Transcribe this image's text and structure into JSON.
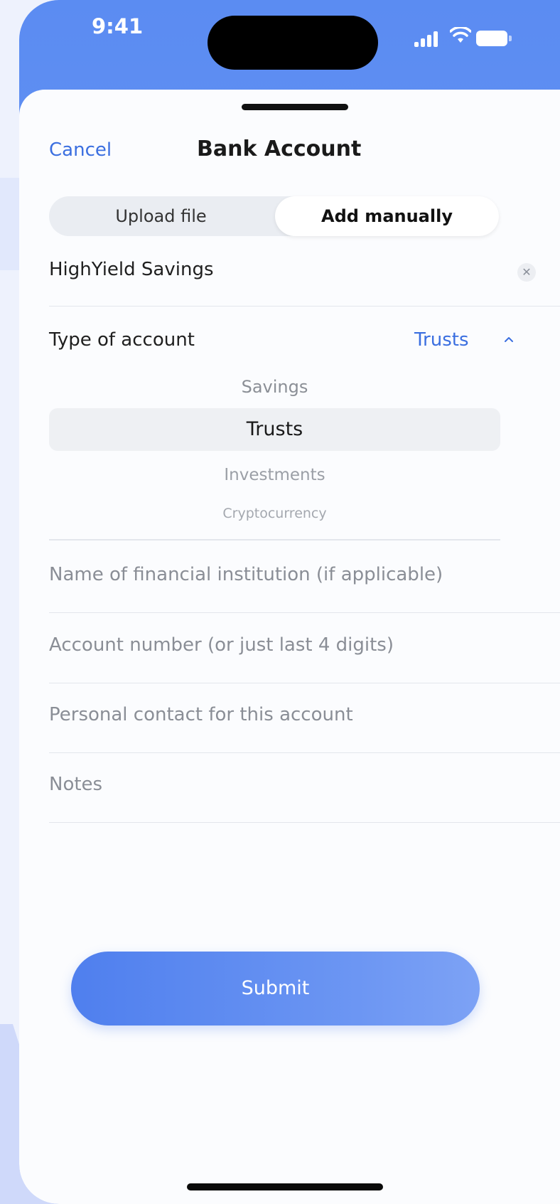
{
  "status_bar": {
    "time": "9:41"
  },
  "header": {
    "cancel_label": "Cancel",
    "title": "Bank Account"
  },
  "segmented": {
    "options": [
      "Upload file",
      "Add manually"
    ],
    "selected": "Add manually"
  },
  "account_name": {
    "value": "HighYield Savings"
  },
  "account_type": {
    "label": "Type of account",
    "selected": "Trusts",
    "options": [
      "Savings",
      "Trusts",
      "Investments",
      "Cryptocurrency"
    ]
  },
  "fields": {
    "institution_placeholder": "Name of financial institution (if applicable)",
    "account_number_placeholder": "Account number (or just last 4 digits)",
    "contact_placeholder": "Personal contact for this account",
    "notes_placeholder": "Notes"
  },
  "submit_label": "Submit",
  "colors": {
    "accent": "#3b6fe0",
    "gradient_start": "#5b8cf2",
    "gradient_end": "#7a9ff5"
  },
  "icons": {
    "clear": "close-icon",
    "collapse": "chevron-up-icon",
    "signal": "signal-icon",
    "wifi": "wifi-icon",
    "battery": "battery-icon"
  }
}
